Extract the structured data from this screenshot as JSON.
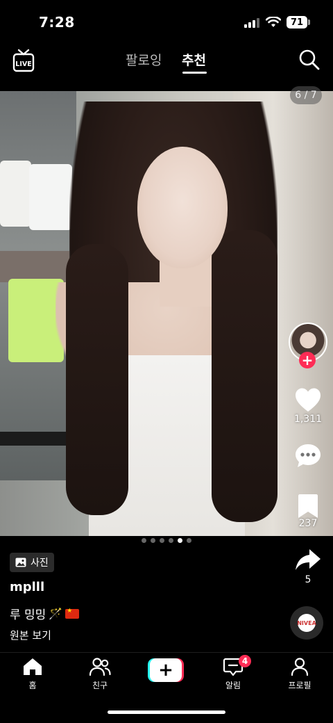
{
  "status_bar": {
    "time": "7:28",
    "battery": "71"
  },
  "top_nav": {
    "live_label": "LIVE",
    "tab_following": "팔로잉",
    "tab_recommended": "추천"
  },
  "post": {
    "photo_counter": "6 / 7",
    "total_photos": 7,
    "current_photo": 6,
    "photo_tag": "사진",
    "username": "mplll",
    "description": "루 밍밍",
    "original_link": "원본 보기",
    "music_label": "NIVEA"
  },
  "rail": {
    "likes": "1,311",
    "saves": "237",
    "shares": "5"
  },
  "bottom_nav": {
    "home": "홈",
    "friends": "친구",
    "create": "+",
    "inbox": "알림",
    "inbox_badge": "4",
    "profile": "프로필"
  },
  "colors": {
    "accent": "#fe2c55",
    "cyan": "#25f4ee",
    "background": "#000000"
  },
  "icons": [
    "live-icon",
    "search-icon",
    "heart-icon",
    "comment-icon",
    "bookmark-icon",
    "share-icon",
    "home-icon",
    "friends-icon",
    "inbox-icon",
    "profile-icon",
    "photo-icon"
  ]
}
